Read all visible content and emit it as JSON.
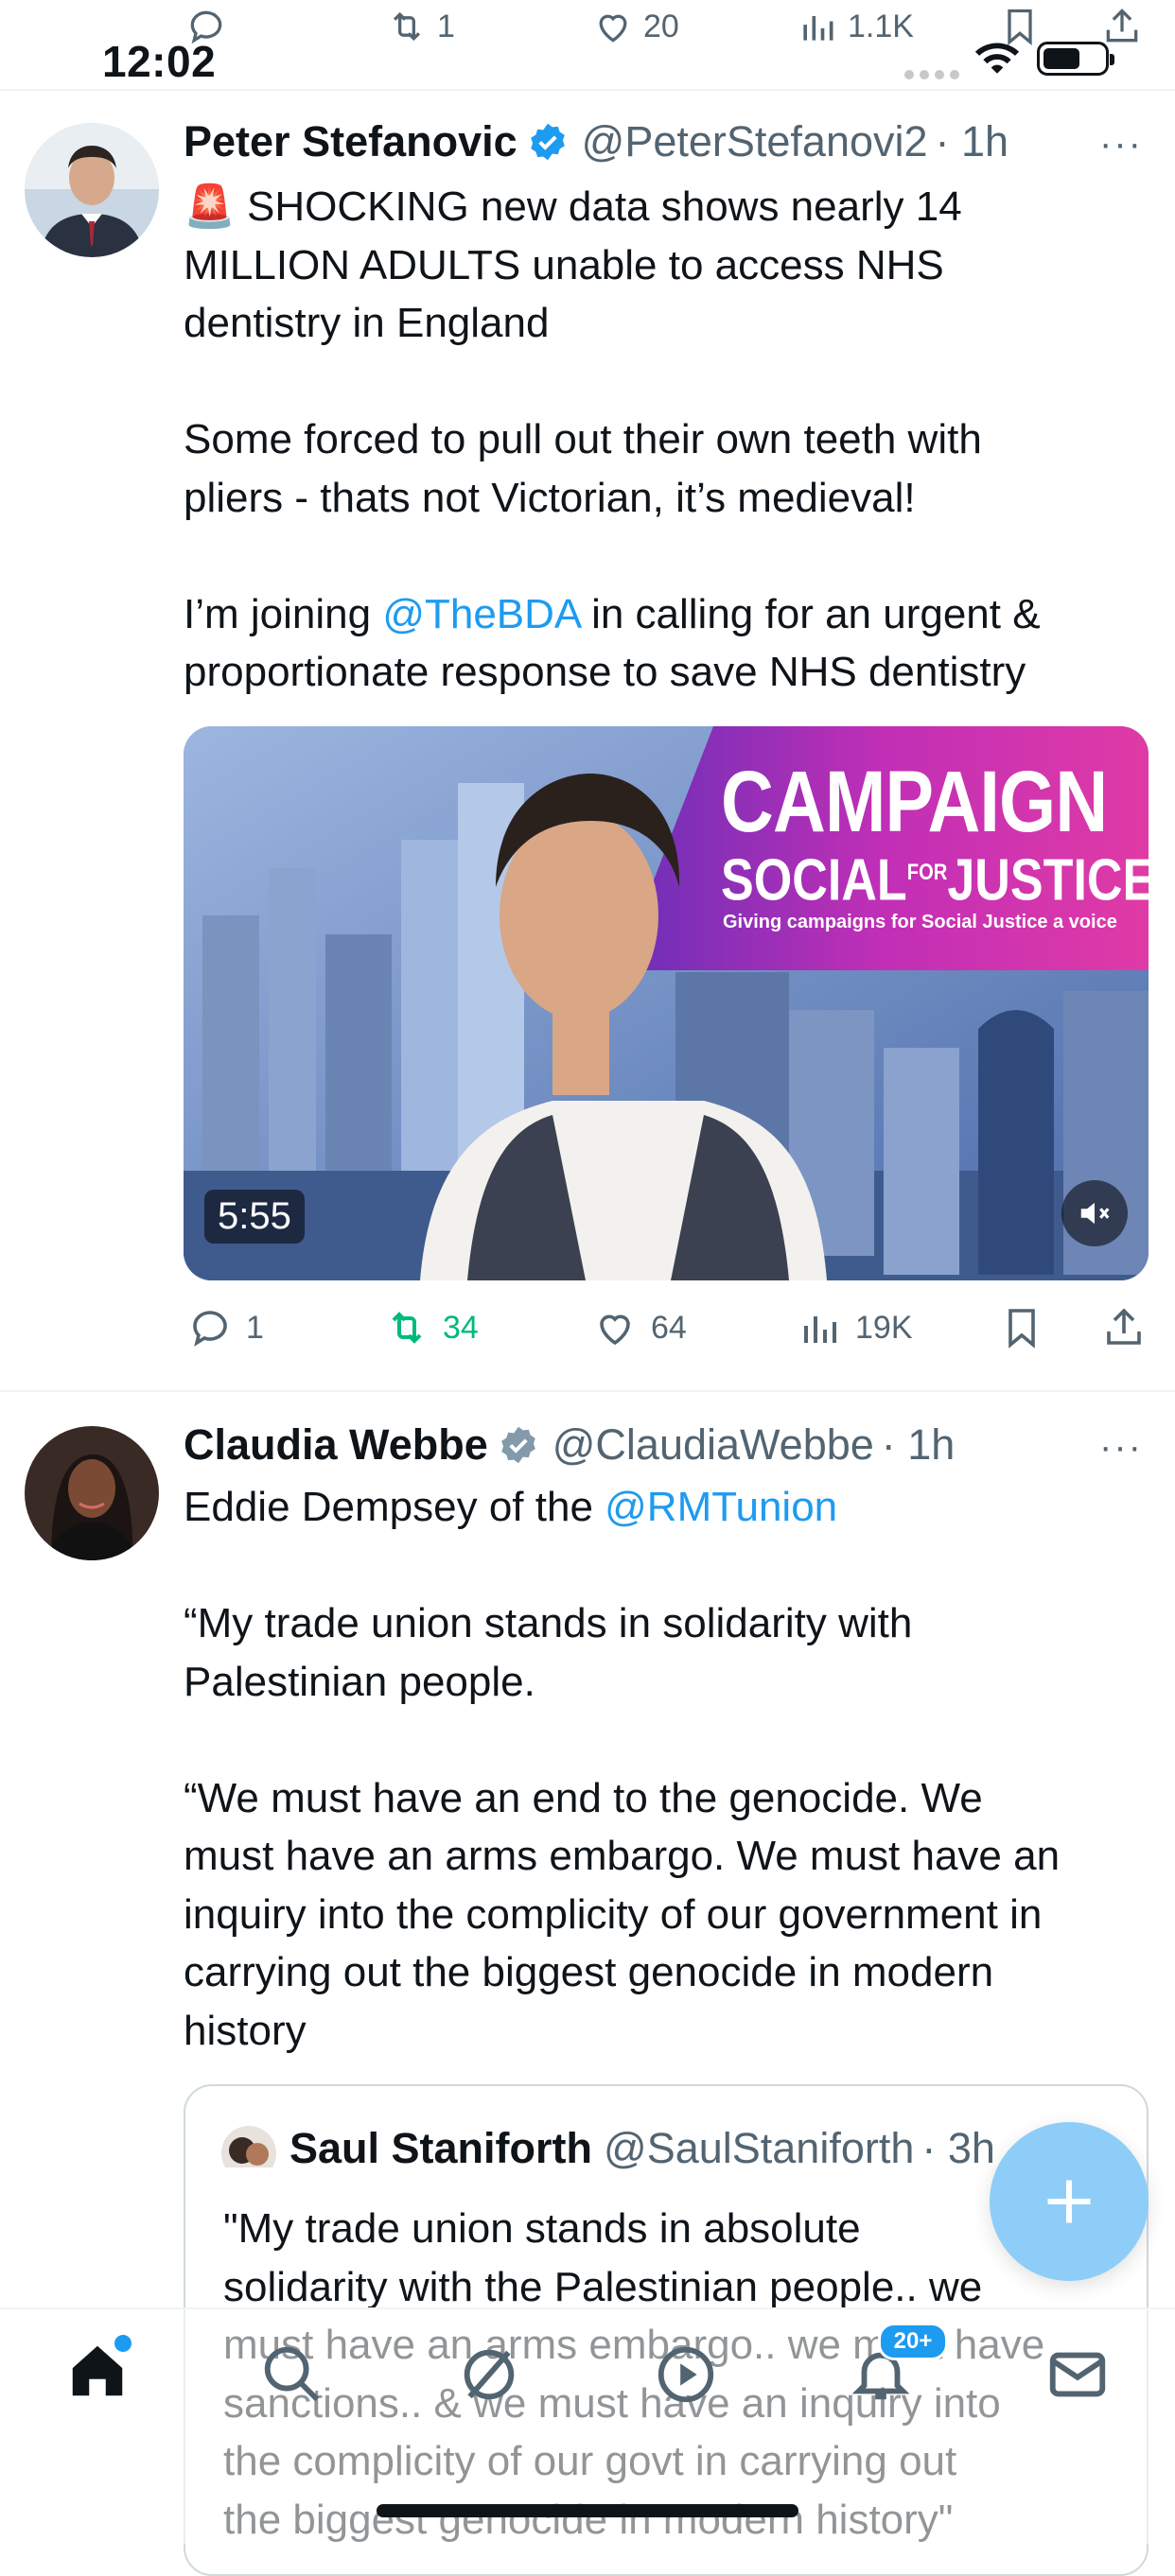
{
  "status_bar": {
    "time": "12:02"
  },
  "prev_tweet_actions": {
    "replies": "",
    "reposts": "1",
    "likes": "20",
    "views": "1.1K"
  },
  "tweets": [
    {
      "name": "Peter Stefanovic",
      "handle": "@PeterStefanovi2",
      "time": "· 1h",
      "more": "···",
      "text_1": "🚨 SHOCKING new data shows nearly 14\nMILLION ADULTS unable to access NHS\ndentistry in England\n\nSome forced to pull out their own teeth with\npliers - thats not Victorian, it’s medieval!\n\nI’m joining ",
      "mention": "@TheBDA",
      "text_2": " in calling for an urgent &\nproportionate response to save NHS dentistry",
      "video": {
        "banner_title": "CAMPAIGN",
        "banner_line2_a": "SOCIAL",
        "banner_line2_for": "FOR",
        "banner_line2_b": "JUSTICE",
        "banner_tagline": "Giving campaigns for Social Justice a voice",
        "duration": "5:55"
      },
      "actions": {
        "replies": "1",
        "reposts": "34",
        "likes": "64",
        "views": "19K"
      },
      "repost_active_color": "#00ba7c"
    },
    {
      "name": "Claudia Webbe",
      "handle": "@ClaudiaWebbe",
      "time": "· 1h",
      "more": "···",
      "text_1": "Eddie Dempsey of the ",
      "mention": "@RMTunion",
      "text_2": "\n\n“My trade union stands in solidarity with\nPalestinian people.\n\n“We must have an end to the genocide. We\nmust have an arms embargo. We must have an\ninquiry into the complicity of our government in\ncarrying out the biggest genocide in modern\nhistory",
      "quote": {
        "name": "Saul Staniforth",
        "handle": "@SaulStaniforth",
        "time": "· 3h",
        "text": "\"My trade union stands in absolute\nsolidarity with the Palestinian people.. we\nmust have an arms embargo.. we must have\nsanctions.. & we must have an inquiry into\nthe complicity of our govt in carrying out\nthe biggest genocide in modern history\""
      }
    }
  ],
  "bottom_nav": {
    "items": [
      "home-icon",
      "search-icon",
      "grok-icon",
      "video-icon",
      "notifications-icon",
      "messages-icon"
    ],
    "notification_badge": "20+"
  },
  "colors": {
    "accent": "#1d9bf0",
    "fab": "#8ecdf8",
    "text": "#0f1419",
    "muted": "#536471"
  }
}
